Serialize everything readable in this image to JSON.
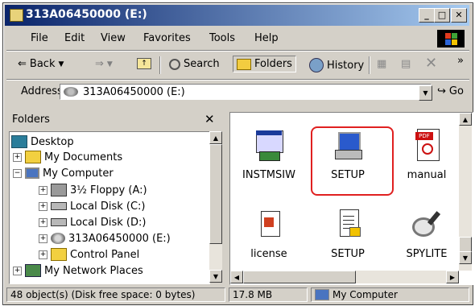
{
  "window": {
    "title": "313A06450000 (E:)",
    "controls": [
      "_",
      "□",
      "✕"
    ]
  },
  "menu": [
    "File",
    "Edit",
    "View",
    "Favorites",
    "Tools",
    "Help"
  ],
  "toolbar": {
    "back": "Back",
    "search": "Search",
    "folders": "Folders",
    "history": "History"
  },
  "address": {
    "label": "Address",
    "value": "313A06450000 (E:)",
    "go": "Go"
  },
  "folders_pane": {
    "title": "Folders",
    "close": "✕",
    "tree": [
      {
        "label": "Desktop",
        "icon": "desktop-icon"
      },
      {
        "label": "My Documents",
        "icon": "my-documents-icon"
      },
      {
        "label": "My Computer",
        "icon": "my-computer-icon"
      },
      {
        "label": "3½ Floppy (A:)",
        "icon": "floppy-drive-icon"
      },
      {
        "label": "Local Disk (C:)",
        "icon": "hard-disk-icon"
      },
      {
        "label": "Local Disk (D:)",
        "icon": "hard-disk-icon"
      },
      {
        "label": "313A06450000 (E:)",
        "icon": "cd-drive-icon"
      },
      {
        "label": "Control Panel",
        "icon": "control-panel-icon"
      },
      {
        "label": "My Network Places",
        "icon": "network-places-icon"
      }
    ]
  },
  "files": [
    {
      "label": "INSTMSIW",
      "icon": "installer-icon"
    },
    {
      "label": "SETUP",
      "icon": "setup-computer-icon"
    },
    {
      "label": "manual",
      "icon": "pdf-icon"
    },
    {
      "label": "license",
      "icon": "license-document-icon"
    },
    {
      "label": "SETUP",
      "icon": "setup-config-icon"
    },
    {
      "label": "SPYLITE",
      "icon": "magnifier-icon"
    }
  ],
  "status": {
    "objects": "48 object(s) (Disk free space: 0 bytes)",
    "size": "17.8 MB",
    "zone": "My Computer"
  },
  "colors": {
    "title_start": "#0a246a",
    "title_end": "#a6caf0",
    "highlight": "#e02020",
    "chrome": "#d4d0c8"
  }
}
